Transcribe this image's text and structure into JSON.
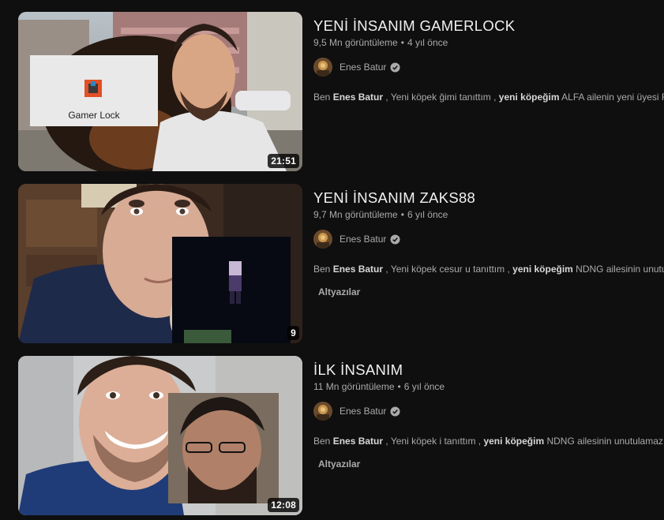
{
  "videos": [
    {
      "title": "YENİ İNSANIM GAMERLOCK",
      "views": "9,5 Mn görüntüleme",
      "age": "4 yıl önce",
      "channel": "Enes Batur",
      "duration": "21:51",
      "overlay_text": "Gamer Lock",
      "desc_prefix": "Ben ",
      "desc_name": "Enes Batur",
      "desc_mid": " , Yeni köpek ğimi tanıttım , ",
      "desc_bold": "yeni köpeğim",
      "desc_tail": " ALFA ailenin yeni üyesi Rot"
    },
    {
      "title": "YENİ İNSANIM ZAKS88",
      "views": "9,7 Mn görüntüleme",
      "age": "6 yıl önce",
      "channel": "Enes Batur",
      "duration": "9",
      "desc_prefix": "Ben ",
      "desc_name": "Enes Batur",
      "desc_mid": " , Yeni köpek cesur u tanıttım , ",
      "desc_bold": "yeni köpeğim",
      "desc_tail": " NDNG ailesinin unutular",
      "badge": "Altyazılar"
    },
    {
      "title": "İLK İNSANIM",
      "views": "11 Mn görüntüleme",
      "age": "6 yıl önce",
      "channel": "Enes Batur",
      "duration": "12:08",
      "desc_prefix": "Ben ",
      "desc_name": "Enes Batur",
      "desc_mid": " , Yeni köpek i tanıttım , ",
      "desc_bold": "yeni köpeğim",
      "desc_tail": " NDNG ailesinin unutulamaz üye",
      "badge": "Altyazılar"
    }
  ],
  "separator": "•",
  "icons": {
    "verified": "verified-check-icon"
  },
  "colors": {
    "background": "#0f0f0f",
    "title": "#f1f1f1",
    "secondary": "#aaaaaa"
  }
}
